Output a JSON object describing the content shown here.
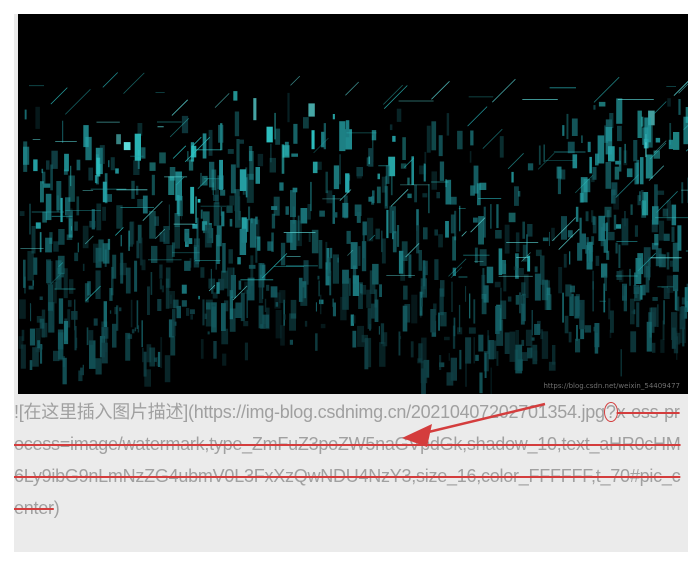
{
  "article": {
    "image_alt": "在这里插入图片描述",
    "image_watermark": "https://blog.csdn.net/weixin_54409477"
  },
  "markdown": {
    "prefix": "![",
    "alt": "在这里插入图片描述",
    "mid": "](",
    "url_base": "https://img-blog.csdnimg.cn/20210407202701354.jpg",
    "query_mark": "?",
    "query_params": "x-oss-process=image/watermark,type_ZmFuZ3poZW5naGVpdGk,shadow_10,text_aHR0cHM6Ly9ibG9nLmNzZG4ubmV0L3FxXzQwNDU4NzY3,size_16,color_FFFFFF,t_70#pic_center",
    "suffix": ")"
  },
  "colors": {
    "panel_bg": "#ebebeb",
    "text": "#a0a0a0",
    "annotation": "#d43d3d",
    "image_bg": "#000000",
    "image_accent": "#2ec4c4"
  },
  "icons": {
    "annotation_arrow": "arrow-left-icon",
    "annotation_circle": "circle-highlight-icon"
  }
}
